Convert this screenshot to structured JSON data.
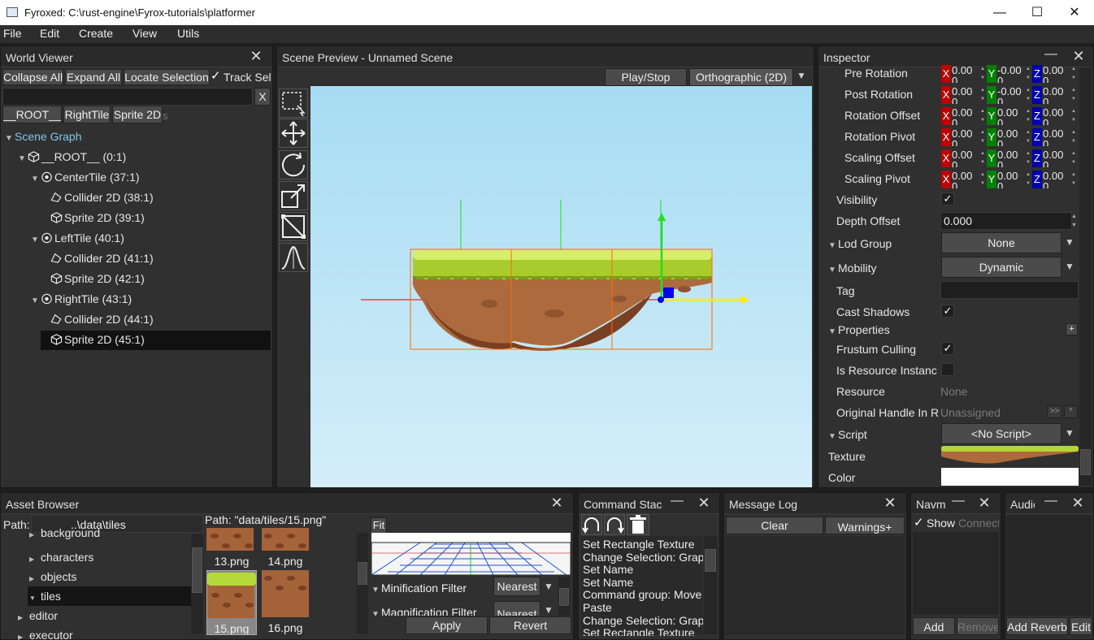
{
  "window": {
    "title": "Fyroxed: C:\\rust-engine\\Fyrox-tutorials\\platformer",
    "minimize": "—",
    "maximize": "☐",
    "close": "✕"
  },
  "menu": [
    "File",
    "Edit",
    "Create",
    "View",
    "Utils"
  ],
  "world_viewer": {
    "title": "World Viewer",
    "buttons": [
      "Collapse All",
      "Expand All",
      "Locate Selection"
    ],
    "track_selection": "Track Sel",
    "search_clear": "X",
    "breadcrumbs": [
      "__ROOT__",
      "RightTile",
      "Sprite 2D"
    ],
    "breadcrumb_ghost": "s",
    "tree": [
      {
        "label": "Scene Graph",
        "depth": 0,
        "kind": "root"
      },
      {
        "label": "__ROOT__ (0:1)",
        "depth": 1,
        "kind": "cube"
      },
      {
        "label": "CenterTile (37:1)",
        "depth": 2,
        "kind": "pivot"
      },
      {
        "label": "Collider 2D (38:1)",
        "depth": 3,
        "kind": "collider"
      },
      {
        "label": "Sprite 2D (39:1)",
        "depth": 3,
        "kind": "cube"
      },
      {
        "label": "LeftTile (40:1)",
        "depth": 2,
        "kind": "pivot"
      },
      {
        "label": "Collider 2D (41:1)",
        "depth": 3,
        "kind": "collider"
      },
      {
        "label": "Sprite 2D (42:1)",
        "depth": 3,
        "kind": "cube"
      },
      {
        "label": "RightTile (43:1)",
        "depth": 2,
        "kind": "pivot"
      },
      {
        "label": "Collider 2D (44:1)",
        "depth": 3,
        "kind": "collider"
      },
      {
        "label": "Sprite 2D (45:1)",
        "depth": 3,
        "kind": "cube",
        "selected": true
      }
    ]
  },
  "scene_preview": {
    "title": "Scene Preview - Unnamed Scene",
    "play_stop": "Play/Stop",
    "projection": "Orthographic (2D)",
    "tools": [
      "select-tool-icon",
      "move-tool-icon",
      "rotate-tool-icon",
      "scale-tool-icon",
      "resize-tool-icon",
      "curve-tool-icon"
    ]
  },
  "inspector": {
    "title": "Inspector",
    "minimize": "—",
    "vector_rows": [
      {
        "label": "Pre Rotation",
        "x": "0.00",
        "y": "-0.00",
        "z": "0.00"
      },
      {
        "label": "Post Rotation",
        "x": "0.00",
        "y": "-0.00",
        "z": "0.00"
      },
      {
        "label": "Rotation Offset",
        "x": "0.00",
        "y": "0.00",
        "z": "0.00"
      },
      {
        "label": "Rotation Pivot",
        "x": "0.00",
        "y": "0.00",
        "z": "0.00"
      },
      {
        "label": "Scaling Offset",
        "x": "0.00",
        "y": "0.00",
        "z": "0.00"
      },
      {
        "label": "Scaling Pivot",
        "x": "0.00",
        "y": "0.00",
        "z": "0.00"
      }
    ],
    "vector_second_line": "0",
    "axis_labels": {
      "x": "X",
      "y": "Y",
      "z": "Z"
    },
    "visibility": "Visibility",
    "depth_offset": "Depth Offset",
    "depth_offset_value": "0.000",
    "lod_group": "Lod Group",
    "lod_group_value": "None",
    "mobility": "Mobility",
    "mobility_value": "Dynamic",
    "tag": "Tag",
    "cast_shadows": "Cast Shadows",
    "properties": "Properties",
    "add_property": "+",
    "frustum_culling": "Frustum Culling",
    "is_resource_instance": "Is Resource Instanc",
    "resource": "Resource",
    "resource_value": "None",
    "original_handle": "Original Handle In R",
    "original_handle_value": "Unassigned",
    "original_handle_more": ">>",
    "original_handle_dot": "*",
    "script": "Script",
    "script_value": "<No Script>",
    "texture": "Texture",
    "color": "Color",
    "checkmark": "✓",
    "dropdown_arrow": "▼"
  },
  "asset_browser": {
    "title": "Asset Browser",
    "path_label": "Path:",
    "path_value": "..\\data\\tiles",
    "preview_path": "Path: \"data/tiles/15.png\"",
    "folders": [
      {
        "label": "background",
        "depth": 1,
        "expanded": false
      },
      {
        "label": "characters",
        "depth": 1,
        "expanded": false
      },
      {
        "label": "objects",
        "depth": 1,
        "expanded": false
      },
      {
        "label": "tiles",
        "depth": 1,
        "expanded": true,
        "selected": true
      },
      {
        "label": "editor",
        "depth": 0,
        "expanded": false
      },
      {
        "label": "executor",
        "depth": 0,
        "expanded": false
      }
    ],
    "files": [
      "13.png",
      "14.png",
      "15.png",
      "16.png"
    ],
    "fit": "Fit",
    "minification_filter": "Minification Filter",
    "magnification_filter": "Magnification Filter",
    "filter_value": "Nearest",
    "apply": "Apply",
    "revert": "Revert"
  },
  "command_stack": {
    "title": "Command Stac",
    "commands": [
      "Set Rectangle Texture",
      "Change Selection: Grap",
      "Set Name",
      "Set Name",
      "Command group: Move",
      "Paste",
      "Change Selection: Grap",
      "Set Rectangle Texture"
    ]
  },
  "message_log": {
    "title": "Message Log",
    "clear": "Clear",
    "warnings": "Warnings+"
  },
  "navmesh": {
    "title": "Navm",
    "show": "Show",
    "connect": "Connect",
    "add": "Add",
    "remove": "Remove"
  },
  "audio": {
    "title": "Audio",
    "add_reverb": "Add Reverb",
    "edit": "Edit"
  },
  "colors": {
    "axis_x": "#c00000",
    "axis_y": "#008000",
    "axis_z": "#0000b0",
    "gizmo_x": "#ffee00",
    "gizmo_y": "#22dd22",
    "selection": "#111111"
  }
}
